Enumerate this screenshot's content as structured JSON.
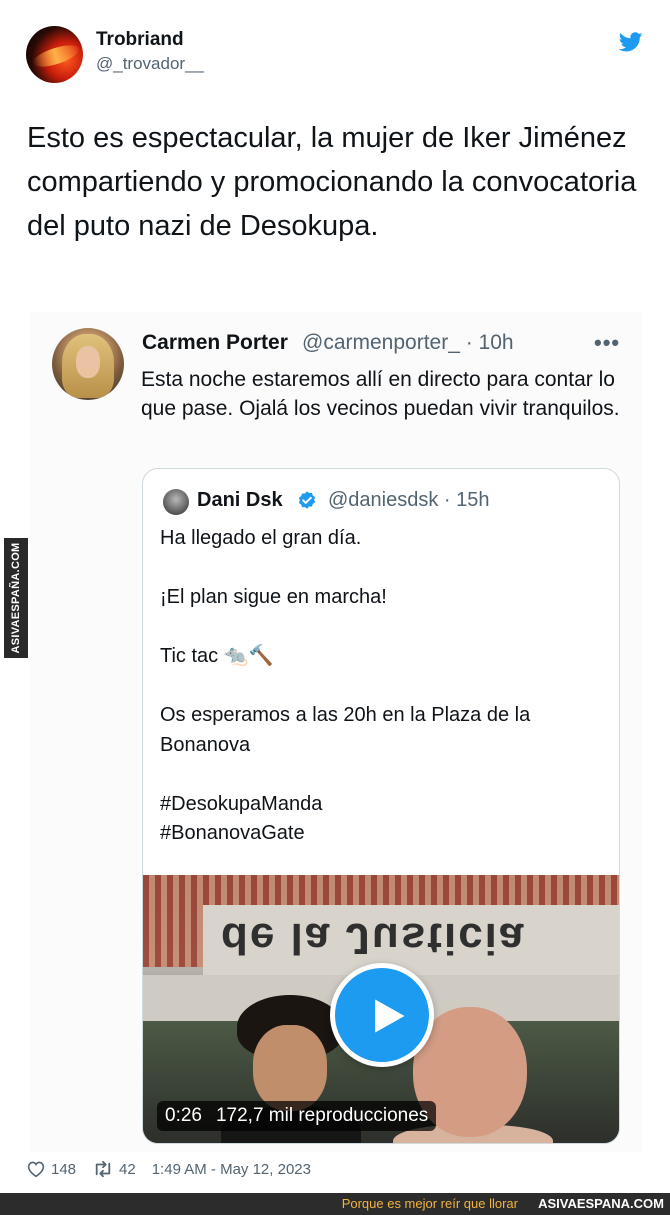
{
  "tweet": {
    "author": {
      "display_name": "Trobriand",
      "handle": "@_trovador__"
    },
    "text": "Esto es espectacular, la mujer de Iker Jiménez compartiendo y promocionando la convocatoria del puto nazi de Desokupa.",
    "footer": {
      "likes": "148",
      "retweets": "42",
      "timestamp": "1:49 AM - May 12, 2023"
    }
  },
  "embedded_tweet": {
    "author": {
      "display_name": "Carmen Porter",
      "handle_time": "@carmenporter_ · 10h"
    },
    "text": "Esta noche estaremos allí en directo para contar lo que pase. Ojalá los vecinos puedan vivir tranquilos.",
    "quoted": {
      "author": {
        "display_name": "Dani Dsk",
        "handle_time": "@daniesdsk · 15h"
      },
      "lines": [
        "Ha llegado el gran día.",
        "",
        "¡El plan sigue en marcha!",
        "",
        "Tic tac 🐀🔨",
        "",
        "Os esperamos a las 20h en la Plaza de la Bonanova",
        "",
        "#DesokupaManda",
        "#BonanovaGate"
      ],
      "video": {
        "sign_text": "de la Justicia",
        "duration": "0:26",
        "views": "172,7 mil reproducciones"
      }
    }
  },
  "watermark": {
    "side": "ASIVAESPAÑA.COM",
    "slogan": "Porque es mejor reír que llorar",
    "site": "ASIVAESPANA.COM"
  },
  "icons": {
    "brand": "twitter-bird-icon",
    "more": "more-options-icon",
    "verified": "verified-badge-icon",
    "play": "play-icon",
    "like": "heart-icon",
    "retweet": "retweet-icon"
  },
  "colors": {
    "twitter_blue": "#1d9bf0",
    "secondary_text": "#536471",
    "watermark_orange": "#f3b33d"
  }
}
